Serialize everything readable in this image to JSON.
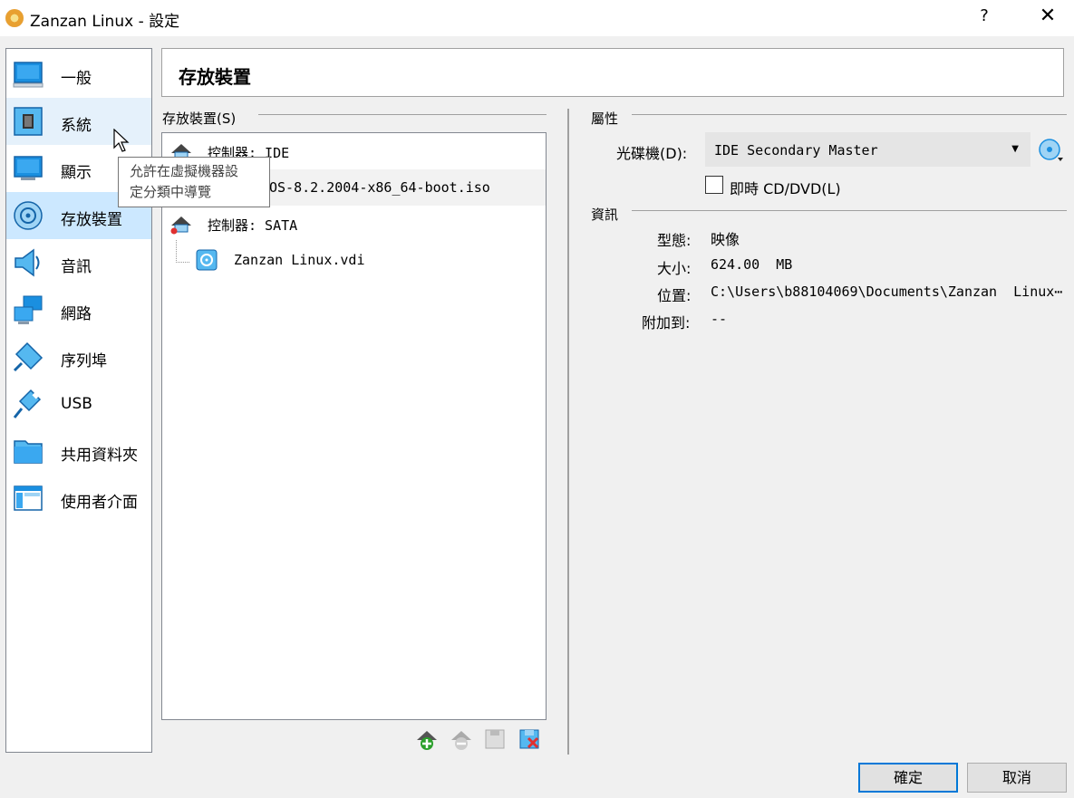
{
  "window": {
    "title": "Zanzan Linux - 設定",
    "help_label": "?",
    "close_label": "✕"
  },
  "nav": {
    "items": [
      {
        "label": "一般",
        "icon": "general-monitor-icon"
      },
      {
        "label": "系統",
        "icon": "system-chip-icon"
      },
      {
        "label": "顯示",
        "icon": "display-monitor-icon"
      },
      {
        "label": "存放裝置",
        "icon": "storage-disk-icon"
      },
      {
        "label": "音訊",
        "icon": "audio-speaker-icon"
      },
      {
        "label": "網路",
        "icon": "network-icon"
      },
      {
        "label": "序列埠",
        "icon": "serial-port-icon"
      },
      {
        "label": "USB",
        "icon": "usb-icon"
      },
      {
        "label": "共用資料夾",
        "icon": "shared-folder-icon"
      },
      {
        "label": "使用者介面",
        "icon": "user-interface-icon"
      }
    ]
  },
  "tooltip": {
    "line1": "允許在虛擬機器設",
    "line2": "定分類中導覽"
  },
  "page": {
    "title": "存放裝置"
  },
  "storage": {
    "group_label": "存放裝置(S)",
    "tree": [
      {
        "label": "控制器: IDE",
        "kind": "controller"
      },
      {
        "label": "CentOS-8.2.2004-x86_64-boot.iso",
        "kind": "optical",
        "visible_label": "OS-8.2.2004-x86_64-boot.iso"
      },
      {
        "label": "控制器: SATA",
        "kind": "controller"
      },
      {
        "label": "Zanzan Linux.vdi",
        "kind": "disk"
      }
    ],
    "toolbar": [
      "add-attachment-icon",
      "remove-attachment-icon",
      "add-controller-icon",
      "remove-controller-icon"
    ]
  },
  "attributes": {
    "group_label": "屬性",
    "optical_drive_label": "光碟機(D):",
    "optical_drive_value": "IDE Secondary Master",
    "live_cd_label": "即時 CD/DVD(L)",
    "live_cd_checked": false
  },
  "info": {
    "group_label": "資訊",
    "type_label": "型態:",
    "type_value": "映像",
    "size_label": "大小:",
    "size_value": "624.00  MB",
    "location_label": "位置:",
    "location_value": "C:\\Users\\b88104069\\Documents\\Zanzan  Linux⋯",
    "attached_label": "附加到:",
    "attached_value": "--"
  },
  "buttons": {
    "ok": "確定",
    "cancel": "取消"
  },
  "colors": {
    "accent": "#0078d7",
    "nav_selected": "#cce8ff",
    "nav_hover": "#e5f1fb",
    "icon_blue": "#1e90ff"
  }
}
